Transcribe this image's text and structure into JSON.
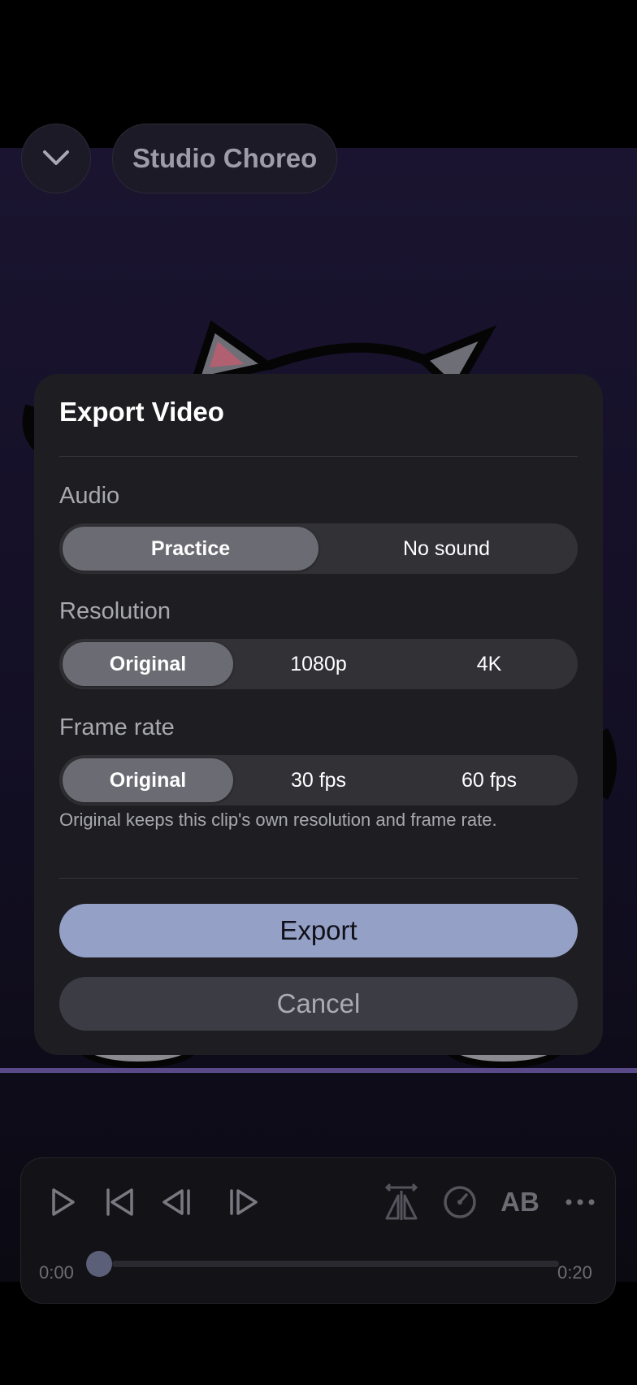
{
  "header": {
    "collapse_icon": "chevron-down-icon",
    "title": "Studio Choreo"
  },
  "export_dialog": {
    "title": "Export Video",
    "audio": {
      "label": "Audio",
      "options": [
        "Practice",
        "No sound"
      ],
      "selected": "Practice"
    },
    "resolution": {
      "label": "Resolution",
      "options": [
        "Original",
        "1080p",
        "4K"
      ],
      "selected": "Original"
    },
    "frame_rate": {
      "label": "Frame rate",
      "options": [
        "Original",
        "30 fps",
        "60 fps"
      ],
      "selected": "Original"
    },
    "hint": "Original keeps this clip's own resolution and frame rate.",
    "export_label": "Export",
    "cancel_label": "Cancel"
  },
  "player": {
    "controls": [
      "play-icon",
      "skip-start-icon",
      "step-back-icon",
      "step-forward-icon",
      "mirror-icon",
      "speed-icon",
      "ab-loop",
      "more-icon"
    ],
    "ab_label": "AB",
    "current_time": "0:00",
    "duration": "0:20",
    "progress": 0
  },
  "colors": {
    "accent": "#95a0c6",
    "dialog_bg": "#1e1e22",
    "segment_selected": "#6b6b73"
  }
}
